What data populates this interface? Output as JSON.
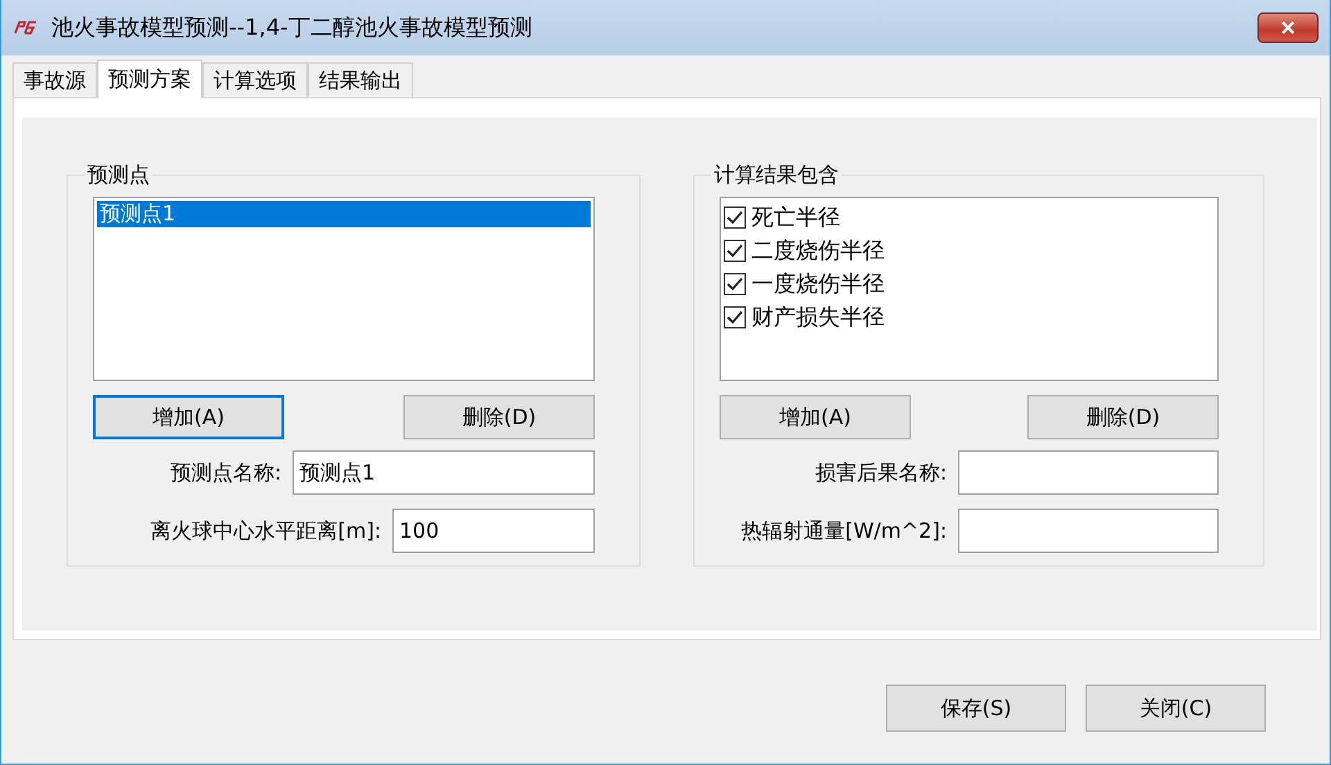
{
  "window": {
    "title": "池火事故模型预测--1,4-丁二醇池火事故模型预测",
    "close": "×"
  },
  "tabs": [
    {
      "label": "事故源",
      "selected": false
    },
    {
      "label": "预测方案",
      "selected": true
    },
    {
      "label": "计算选项",
      "selected": false
    },
    {
      "label": "结果输出",
      "selected": false
    }
  ],
  "points_group": {
    "title": "预测点",
    "items": [
      {
        "label": "预测点1",
        "selected": true
      }
    ],
    "buttons": [
      {
        "label": "增加(A)",
        "focused": true
      },
      {
        "label": "删除(D)",
        "focused": false
      }
    ],
    "fields": [
      {
        "label": "预测点名称:",
        "value": "预测点1"
      },
      {
        "label": "离火球中心水平距离[m]:",
        "value": "100"
      }
    ]
  },
  "results_group": {
    "title": "计算结果包含",
    "items": [
      {
        "label": "死亡半径",
        "checked": true
      },
      {
        "label": "二度烧伤半径",
        "checked": true
      },
      {
        "label": "一度烧伤半径",
        "checked": true
      },
      {
        "label": "财产损失半径",
        "checked": true
      }
    ],
    "buttons": [
      {
        "label": "增加(A)",
        "focused": false
      },
      {
        "label": "删除(D)",
        "focused": false
      }
    ],
    "fields": [
      {
        "label": "损害后果名称:"
      },
      {
        "label": "热辐射通量[W/m^2]:"
      }
    ]
  },
  "buttons": [
    "保存(S)",
    "关闭(C)"
  ]
}
